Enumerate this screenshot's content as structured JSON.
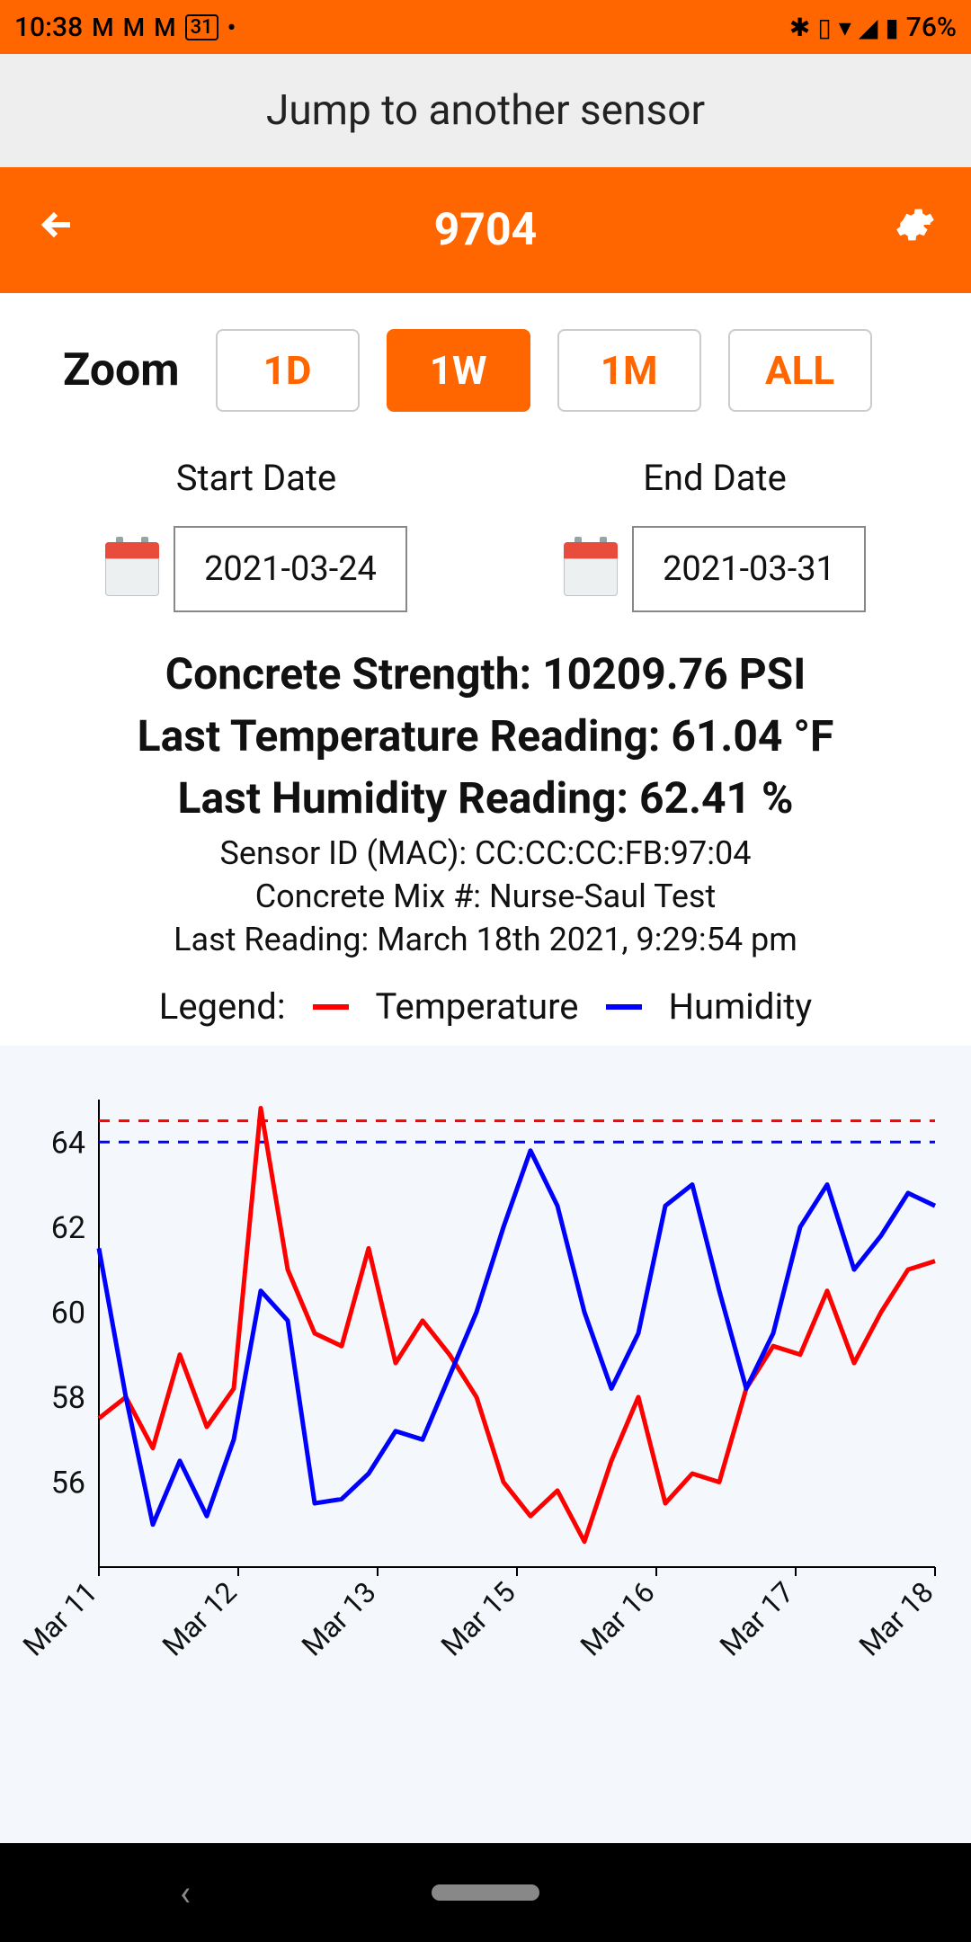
{
  "status": {
    "time": "10:38",
    "battery": "76%"
  },
  "jump_label": "Jump to another sensor",
  "title": "9704",
  "zoom": {
    "label": "Zoom",
    "options": [
      "1D",
      "1W",
      "1M",
      "ALL"
    ],
    "active": "1W"
  },
  "dates": {
    "start_label": "Start Date",
    "end_label": "End Date",
    "start": "2021-03-24",
    "end": "2021-03-31"
  },
  "readings": {
    "strength": "Concrete Strength: 10209.76 PSI",
    "temp": "Last Temperature Reading: 61.04 °F",
    "humidity": "Last Humidity Reading: 62.41 %",
    "sensor_id": "Sensor ID (MAC): CC:CC:CC:FB:97:04",
    "mix": "Concrete Mix #: Nurse-Saul Test",
    "last_reading": "Last Reading: March 18th 2021, 9:29:54 pm"
  },
  "legend": {
    "label": "Legend:",
    "items": [
      {
        "name": "Temperature",
        "color": "#ff0000"
      },
      {
        "name": "Humidity",
        "color": "#0000ff"
      }
    ]
  },
  "chart_data": {
    "type": "line",
    "xlabel": "",
    "ylabel": "",
    "ylim": [
      54,
      65
    ],
    "x_ticks": [
      "Mar 11",
      "Mar 12",
      "Mar 13",
      "Mar 15",
      "Mar 16",
      "Mar 17",
      "Mar 18"
    ],
    "y_ticks": [
      56,
      58,
      60,
      62,
      64
    ],
    "reference_lines": [
      {
        "value": 64.5,
        "color": "#ff0000",
        "style": "dashed"
      },
      {
        "value": 64.0,
        "color": "#0000ff",
        "style": "dashed"
      }
    ],
    "series": [
      {
        "name": "Temperature",
        "color": "#ff0000",
        "values": [
          57.5,
          58.0,
          56.8,
          59.0,
          57.3,
          58.2,
          64.8,
          61.0,
          59.5,
          59.2,
          61.5,
          58.8,
          59.8,
          59.0,
          58.0,
          56.0,
          55.2,
          55.8,
          54.6,
          56.5,
          58.0,
          55.5,
          56.2,
          56.0,
          58.2,
          59.2,
          59.0,
          60.5,
          58.8,
          60.0,
          61.0,
          61.2
        ]
      },
      {
        "name": "Humidity",
        "color": "#0000ff",
        "values": [
          61.5,
          58.0,
          55.0,
          56.5,
          55.2,
          57.0,
          60.5,
          59.8,
          55.5,
          55.6,
          56.2,
          57.2,
          57.0,
          58.5,
          60.0,
          62.0,
          63.8,
          62.5,
          60.0,
          58.2,
          59.5,
          62.5,
          63.0,
          60.5,
          58.2,
          59.5,
          62.0,
          63.0,
          61.0,
          61.8,
          62.8,
          62.5
        ]
      }
    ]
  }
}
